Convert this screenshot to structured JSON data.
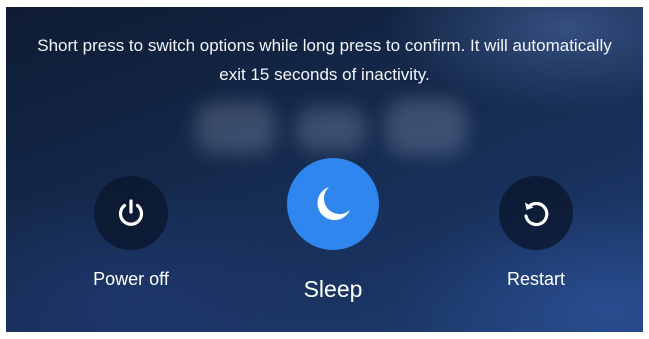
{
  "dialog": {
    "instruction": "Short press to switch options while long press to confirm. It will automatically exit 15 seconds of inactivity."
  },
  "options": [
    {
      "label": "Power off",
      "icon": "power-icon",
      "selected": false
    },
    {
      "label": "Sleep",
      "icon": "moon-icon",
      "selected": true
    },
    {
      "label": "Restart",
      "icon": "restart-icon",
      "selected": false
    }
  ],
  "colors": {
    "selected_accent": "#2e86ee",
    "unselected_circle": "#0a162c",
    "background": "#14284a",
    "text": "#ffffff"
  }
}
